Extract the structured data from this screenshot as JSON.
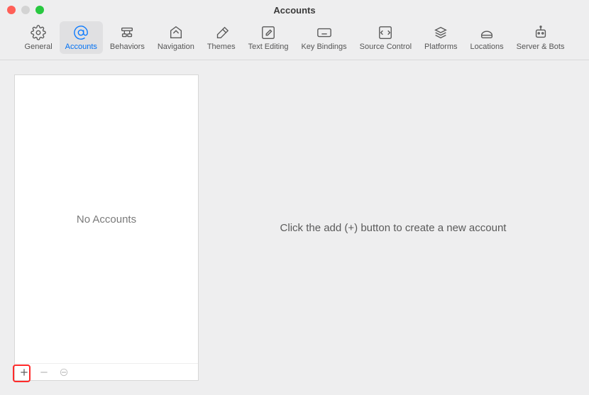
{
  "window": {
    "title": "Accounts"
  },
  "toolbar": {
    "items": [
      {
        "id": "general",
        "label": "General",
        "selected": false
      },
      {
        "id": "accounts",
        "label": "Accounts",
        "selected": true
      },
      {
        "id": "behaviors",
        "label": "Behaviors",
        "selected": false
      },
      {
        "id": "navigation",
        "label": "Navigation",
        "selected": false
      },
      {
        "id": "themes",
        "label": "Themes",
        "selected": false
      },
      {
        "id": "text-editing",
        "label": "Text Editing",
        "selected": false
      },
      {
        "id": "key-bindings",
        "label": "Key Bindings",
        "selected": false
      },
      {
        "id": "source-control",
        "label": "Source Control",
        "selected": false
      },
      {
        "id": "platforms",
        "label": "Platforms",
        "selected": false
      },
      {
        "id": "locations",
        "label": "Locations",
        "selected": false
      },
      {
        "id": "server-bots",
        "label": "Server & Bots",
        "selected": false
      }
    ]
  },
  "sidebar": {
    "empty_label": "No Accounts"
  },
  "main": {
    "message": "Click the add (+) button to create a new account"
  }
}
